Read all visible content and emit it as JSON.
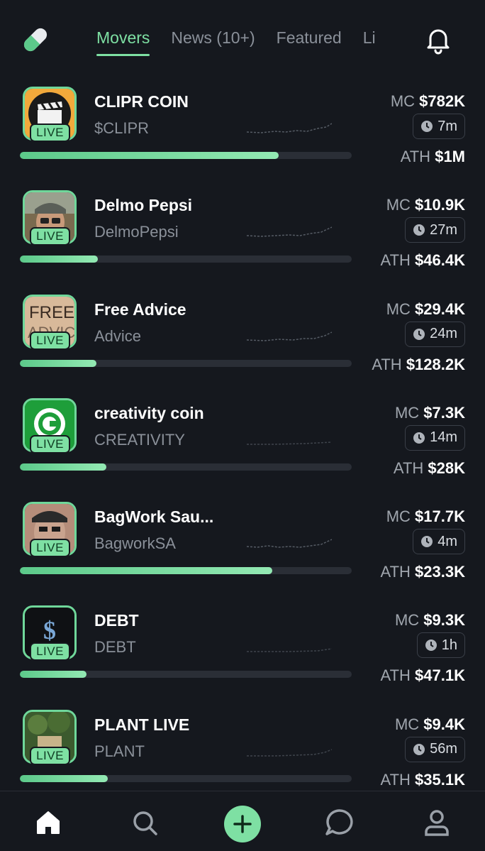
{
  "tabs": [
    {
      "label": "Movers",
      "active": true
    },
    {
      "label": "News (10+)",
      "active": false
    },
    {
      "label": "Featured",
      "active": false
    },
    {
      "label": "Li",
      "active": false
    }
  ],
  "live_label": "LIVE",
  "colors": {
    "accent": "#7ee0a3",
    "background": "#15181e",
    "muted": "#8a9099"
  },
  "coins": [
    {
      "name": "CLIPR COIN",
      "ticker": "$CLIPR",
      "mc_label": "MC",
      "mc": "$782K",
      "age": "7m",
      "ath_label": "ATH",
      "ath": "$1M",
      "progress": 0.78,
      "avatar": "clapperboard-icon"
    },
    {
      "name": "Delmo Pepsi",
      "ticker": "DelmoPepsi",
      "mc_label": "MC",
      "mc": "$10.9K",
      "age": "27m",
      "ath_label": "ATH",
      "ath": "$46.4K",
      "progress": 0.235,
      "avatar": "person-photo"
    },
    {
      "name": "Free Advice",
      "ticker": "Advice",
      "mc_label": "MC",
      "mc": "$29.4K",
      "age": "24m",
      "ath_label": "ATH",
      "ath": "$128.2K",
      "progress": 0.23,
      "avatar": "free-advice-sign"
    },
    {
      "name": "creativity coin",
      "ticker": "CREATIVITY",
      "mc_label": "MC",
      "mc": "$7.3K",
      "age": "14m",
      "ath_label": "ATH",
      "ath": "$28K",
      "progress": 0.26,
      "avatar": "creativity-logo-icon"
    },
    {
      "name": "BagWork Sau...",
      "ticker": "BagworkSA",
      "mc_label": "MC",
      "mc": "$17.7K",
      "age": "4m",
      "ath_label": "ATH",
      "ath": "$23.3K",
      "progress": 0.76,
      "avatar": "person-photo"
    },
    {
      "name": "DEBT",
      "ticker": "DEBT",
      "mc_label": "MC",
      "mc": "$9.3K",
      "age": "1h",
      "ath_label": "ATH",
      "ath": "$47.1K",
      "progress": 0.2,
      "avatar": "dollar-icon"
    },
    {
      "name": "PLANT LIVE",
      "ticker": "PLANT",
      "mc_label": "MC",
      "mc": "$9.4K",
      "age": "56m",
      "ath_label": "ATH",
      "ath": "$35.1K",
      "progress": 0.265,
      "avatar": "plant-photo"
    }
  ],
  "bottom_nav": [
    "home-icon",
    "search-icon",
    "plus-icon",
    "chat-icon",
    "profile-icon"
  ]
}
